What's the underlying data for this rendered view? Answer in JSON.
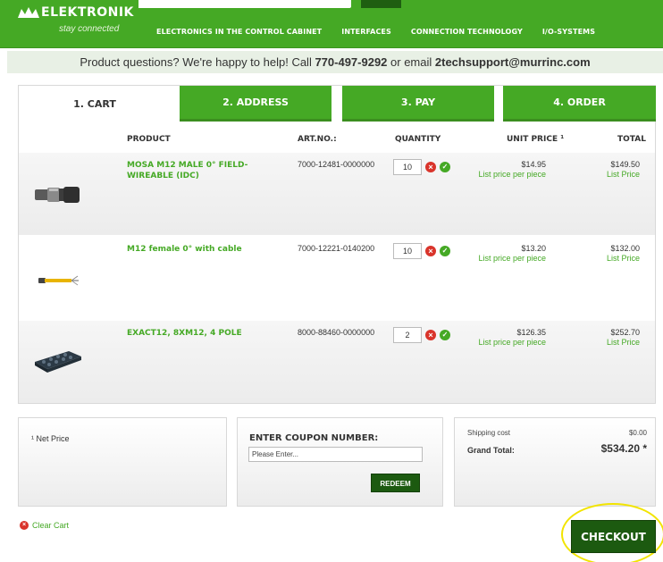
{
  "header": {
    "logo_text": "ELEKTRONIK",
    "tagline": "stay connected",
    "nav": [
      "ELECTRONICS IN THE CONTROL CABINET",
      "INTERFACES",
      "CONNECTION TECHNOLOGY",
      "I/O-SYSTEMS"
    ]
  },
  "info_bar": {
    "text_before": "Product questions? We're happy to help! Call ",
    "phone": "770-497-9292",
    "text_mid": " or email ",
    "email": "2techsupport@murrinc.com"
  },
  "tabs": [
    {
      "label": "1. CART"
    },
    {
      "label": "2. ADDRESS"
    },
    {
      "label": "3. PAY"
    },
    {
      "label": "4. ORDER"
    }
  ],
  "columns": {
    "product": "PRODUCT",
    "artno": "ART.NO.:",
    "quantity": "QUANTITY",
    "unit_price": "UNIT PRICE ¹",
    "total": "TOTAL"
  },
  "items": [
    {
      "name": "MOSA M12 MALE 0° FIELD-WIREABLE (IDC)",
      "artno": "7000-12481-0000000",
      "quantity": "10",
      "unit_price": "$14.95",
      "unit_note": "List price per piece",
      "total": "$149.50",
      "total_note": "List Price",
      "image_icon": "m12-connector-icon"
    },
    {
      "name": "M12 female 0° with cable",
      "artno": "7000-12221-0140200",
      "quantity": "10",
      "unit_price": "$13.20",
      "unit_note": "List price per piece",
      "total": "$132.00",
      "total_note": "List Price",
      "image_icon": "cable-icon"
    },
    {
      "name": "EXACT12, 8XM12, 4 POLE",
      "artno": "8000-88460-0000000",
      "quantity": "2",
      "unit_price": "$126.35",
      "unit_note": "List price per piece",
      "total": "$252.70",
      "total_note": "List Price",
      "image_icon": "distributor-box-icon"
    }
  ],
  "footnote": "¹ Net Price",
  "coupon": {
    "title": "ENTER COUPON NUMBER:",
    "placeholder": "Please Enter...",
    "redeem": "REDEEM"
  },
  "summary": {
    "shipping_label": "Shipping cost",
    "shipping_value": "$0.00",
    "grand_label": "Grand Total:",
    "grand_value": "$534.20 *"
  },
  "clear_cart": "Clear Cart",
  "checkout": "CHECKOUT",
  "colors": {
    "brand_green": "#45a925",
    "dark_green": "#1c5a10",
    "remove_red": "#d9342b",
    "highlight_yellow": "#f2e400"
  }
}
